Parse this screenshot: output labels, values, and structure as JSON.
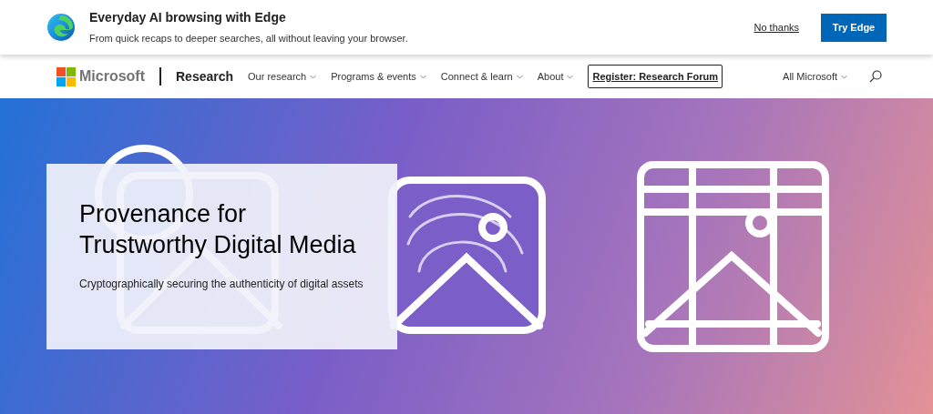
{
  "banner": {
    "title": "Everyday AI browsing with Edge",
    "subtitle": "From quick recaps to deeper searches, all without leaving your browser.",
    "dismiss": "No thanks",
    "action": "Try Edge"
  },
  "nav": {
    "brand": "Microsoft",
    "site": "Research",
    "items": [
      {
        "label": "Our research",
        "kind": "dropdown"
      },
      {
        "label": "Programs & events",
        "kind": "dropdown"
      },
      {
        "label": "Connect & learn",
        "kind": "dropdown"
      },
      {
        "label": "About",
        "kind": "dropdown"
      },
      {
        "label": "Register: Research Forum",
        "kind": "outlined"
      }
    ],
    "all_menu": "All Microsoft"
  },
  "hero": {
    "title": "Provenance for Trustworthy Digital Media",
    "subtitle": "Cryptographically securing the authenticity of digital assets"
  }
}
